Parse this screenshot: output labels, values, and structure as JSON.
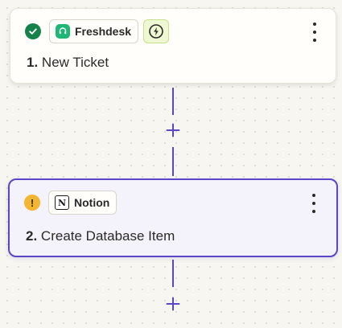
{
  "steps": [
    {
      "number": "1.",
      "title": "New Ticket",
      "app": "Freshdesk",
      "status": "complete",
      "status_icon": "check-circle-icon",
      "app_icon": "freshdesk-headset-icon",
      "trigger_icon": "lightning-bolt-icon",
      "menu_icon": "more-vertical-icon"
    },
    {
      "number": "2.",
      "title": "Create Database Item",
      "app": "Notion",
      "status": "warning",
      "status_icon": "exclamation-circle-icon",
      "status_glyph": "!",
      "app_icon": "notion-logo-icon",
      "app_logo_glyph": "N",
      "menu_icon": "more-vertical-icon"
    }
  ],
  "connectors": {
    "add_icon": "plus-icon"
  },
  "colors": {
    "accent": "#5b46c8",
    "success": "#14824a",
    "warning": "#f3b633",
    "freshdesk_brand": "#1fb775",
    "trigger_bg": "#eef8d2",
    "selected_card_bg": "#f4f2fb",
    "canvas_bg": "#f7f6f1"
  }
}
